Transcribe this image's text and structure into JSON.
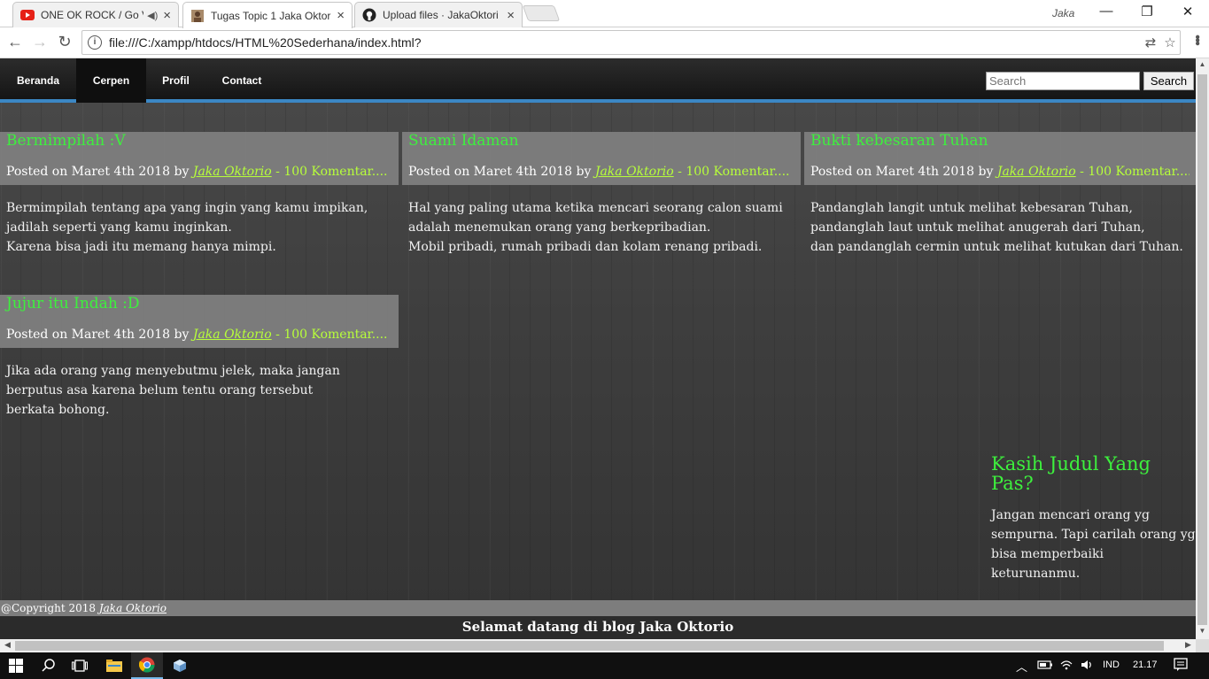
{
  "browser": {
    "tabs": [
      {
        "title": "ONE OK ROCK / Go V",
        "icon": "youtube-icon",
        "audio": true
      },
      {
        "title": "Tugas Topic 1 Jaka Oktor",
        "icon": "page-favicon"
      },
      {
        "title": "Upload files · JakaOktori",
        "icon": "github-icon"
      }
    ],
    "profile": "Jaka",
    "url": "file:///C:/xampp/htdocs/HTML%20Sederhana/index.html?"
  },
  "site": {
    "nav": [
      "Beranda",
      "Cerpen",
      "Profil",
      "Contact"
    ],
    "active_nav": "Cerpen",
    "search_placeholder": "Search",
    "search_button": "Search",
    "posts": [
      {
        "title": "Bermimpilah :V",
        "meta_prefix": "Posted on Maret 4th 2018 by ",
        "author": "Jaka Oktorio",
        "comments": " - 100 Komentar....",
        "lines": [
          "Bermimpilah tentang apa yang ingin yang kamu impikan,",
          "jadilah seperti yang kamu inginkan.",
          "Karena bisa jadi itu memang hanya mimpi."
        ]
      },
      {
        "title": "Suami Idaman",
        "meta_prefix": "Posted on Maret 4th 2018 by ",
        "author": "Jaka Oktorio",
        "comments": " - 100 Komentar....",
        "lines": [
          "Hal yang paling utama ketika mencari seorang calon suami",
          "adalah menemukan orang yang berkepribadian.",
          "Mobil pribadi, rumah pribadi dan kolam renang pribadi."
        ]
      },
      {
        "title": "Bukti kebesaran Tuhan",
        "meta_prefix": "Posted on Maret 4th 2018 by ",
        "author": "Jaka Oktorio",
        "comments": " - 100 Komentar....",
        "lines": [
          "Pandanglah langit untuk melihat kebesaran Tuhan,",
          "pandanglah laut untuk melihat anugerah dari Tuhan,",
          "dan pandanglah cermin untuk melihat kutukan dari Tuhan."
        ]
      },
      {
        "title": "Jujur itu Indah :D",
        "meta_prefix": "Posted on Maret 4th 2018 by ",
        "author": "Jaka Oktorio",
        "comments": " - 100 Komentar....",
        "lines": [
          "Jika ada orang yang menyebutmu jelek, maka jangan",
          "berputus asa karena belum tentu orang tersebut",
          "berkata bohong."
        ]
      }
    ],
    "aside": {
      "title": "Kasih Judul Yang Pas?",
      "lines": [
        "Jangan mencari orang yg",
        "sempurna. Tapi carilah orang yg",
        "bisa memperbaiki",
        "keturunanmu."
      ]
    },
    "copyright_prefix": "@Copyright 2018 ",
    "copyright_author": "Jaka Oktorio",
    "welcome": "Selamat datang di blog Jaka Oktorio"
  },
  "taskbar": {
    "language": "IND",
    "time": "21.17"
  }
}
